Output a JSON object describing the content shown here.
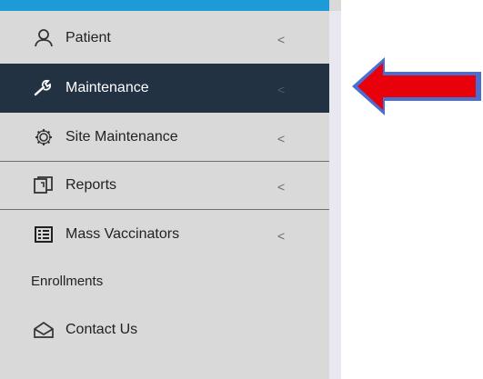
{
  "sidebar": {
    "items": [
      {
        "label": "Patient",
        "icon": "user-icon",
        "chevron": "<"
      },
      {
        "label": "Maintenance",
        "icon": "wrench-icon",
        "chevron": "<",
        "active": true
      },
      {
        "label": "Site Maintenance",
        "icon": "gear-icon",
        "chevron": "<"
      },
      {
        "label": "Reports",
        "icon": "reports-icon",
        "chevron": "<"
      },
      {
        "label": "Mass Vaccinators",
        "icon": "list-icon",
        "chevron": "<"
      }
    ],
    "enrollments_label": "Enrollments",
    "contact_label": "Contact Us",
    "contact_icon": "envelope-icon"
  },
  "annotation": {
    "arrow_color": "#e8000b",
    "arrow_outline_color": "#4a6fd0",
    "arrow_direction": "left"
  },
  "colors": {
    "sidebar_bg": "#d9d9d9",
    "active_bg": "#233243",
    "top_strip": "#1e9bd6"
  }
}
